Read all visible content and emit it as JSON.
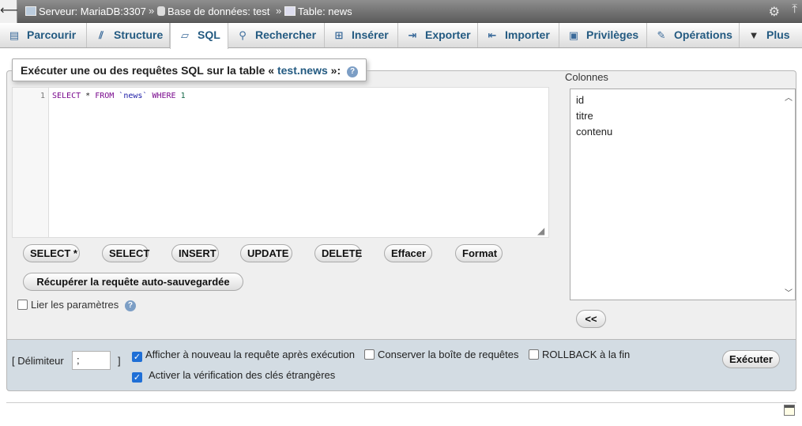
{
  "breadcrumb": {
    "server": "Serveur: MariaDB:3307",
    "database": "Base de données: test",
    "table": "Table: news",
    "separator": "»"
  },
  "tabs": [
    {
      "label": "Parcourir",
      "icon": "browse-icon"
    },
    {
      "label": "Structure",
      "icon": "structure-icon"
    },
    {
      "label": "SQL",
      "icon": "sql-icon"
    },
    {
      "label": "Rechercher",
      "icon": "search-icon"
    },
    {
      "label": "Insérer",
      "icon": "insert-icon"
    },
    {
      "label": "Exporter",
      "icon": "export-icon"
    },
    {
      "label": "Importer",
      "icon": "import-icon"
    },
    {
      "label": "Privilèges",
      "icon": "privileges-icon"
    },
    {
      "label": "Opérations",
      "icon": "operations-icon"
    },
    {
      "label": "Plus",
      "icon": "chevron-down-icon"
    }
  ],
  "active_tab": "SQL",
  "panel": {
    "legend_prefix": "Exécuter une ou des requêtes SQL sur la table «",
    "legend_table": "test.news",
    "legend_suffix": "»:"
  },
  "editor": {
    "line_number": "1",
    "tokens": {
      "select": "SELECT",
      "star": " * ",
      "from": "FROM",
      "table": " `news` ",
      "where": "WHERE",
      "one": " 1"
    }
  },
  "buttons": {
    "select_star": "SELECT *",
    "select": "SELECT",
    "insert": "INSERT",
    "update": "UPDATE",
    "delete": "DELETE",
    "clear": "Effacer",
    "format": "Format",
    "recover": "Récupérer la requête auto-sauvegardée",
    "insert_column": "<<",
    "execute": "Exécuter"
  },
  "bind_params": {
    "label": "Lier les paramètres",
    "checked": false
  },
  "columns": {
    "label": "Colonnes",
    "items": [
      "id",
      "titre",
      "contenu"
    ]
  },
  "options": {
    "delimiter_open": "[ Délimiteur",
    "delimiter_value": ";",
    "delimiter_close": "]",
    "show_query": {
      "label": "Afficher à nouveau la requête après exécution",
      "checked": true
    },
    "retain_box": {
      "label": "Conserver la boîte de requêtes",
      "checked": false
    },
    "rollback": {
      "label": "ROLLBACK à la fin",
      "checked": false
    },
    "fk_check": {
      "label": "Activer la vérification des clés étrangères",
      "checked": true
    }
  },
  "colors": {
    "tab_text": "#235a81",
    "topbar": "#6e6e6e",
    "options_bg": "#d3dce3",
    "checkbox_on": "#1f6fd6"
  }
}
